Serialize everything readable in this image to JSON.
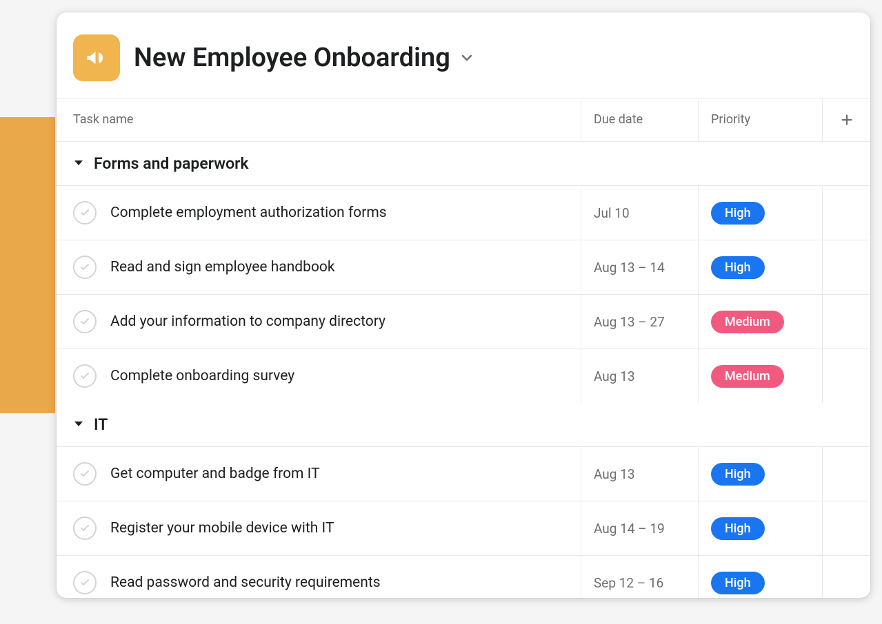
{
  "project": {
    "title": "New Employee Onboarding"
  },
  "columns": {
    "task": "Task name",
    "due": "Due date",
    "priority": "Priority"
  },
  "sections": [
    {
      "title": "Forms and paperwork",
      "tasks": [
        {
          "name": "Complete employment authorization forms",
          "due": "Jul 10",
          "priority": "High",
          "priorityLevel": "high"
        },
        {
          "name": "Read and sign employee handbook",
          "due": "Aug 13 – 14",
          "priority": "High",
          "priorityLevel": "high"
        },
        {
          "name": "Add your information to company directory",
          "due": "Aug 13 – 27",
          "priority": "Medium",
          "priorityLevel": "medium"
        },
        {
          "name": "Complete onboarding survey",
          "due": "Aug 13",
          "priority": "Medium",
          "priorityLevel": "medium"
        }
      ]
    },
    {
      "title": "IT",
      "tasks": [
        {
          "name": "Get computer and badge from IT",
          "due": "Aug 13",
          "priority": "High",
          "priorityLevel": "high"
        },
        {
          "name": "Register your mobile device with IT",
          "due": "Aug 14 – 19",
          "priority": "High",
          "priorityLevel": "high"
        },
        {
          "name": "Read password and security requirements",
          "due": "Sep 12 – 16",
          "priority": "High",
          "priorityLevel": "high"
        }
      ]
    }
  ]
}
